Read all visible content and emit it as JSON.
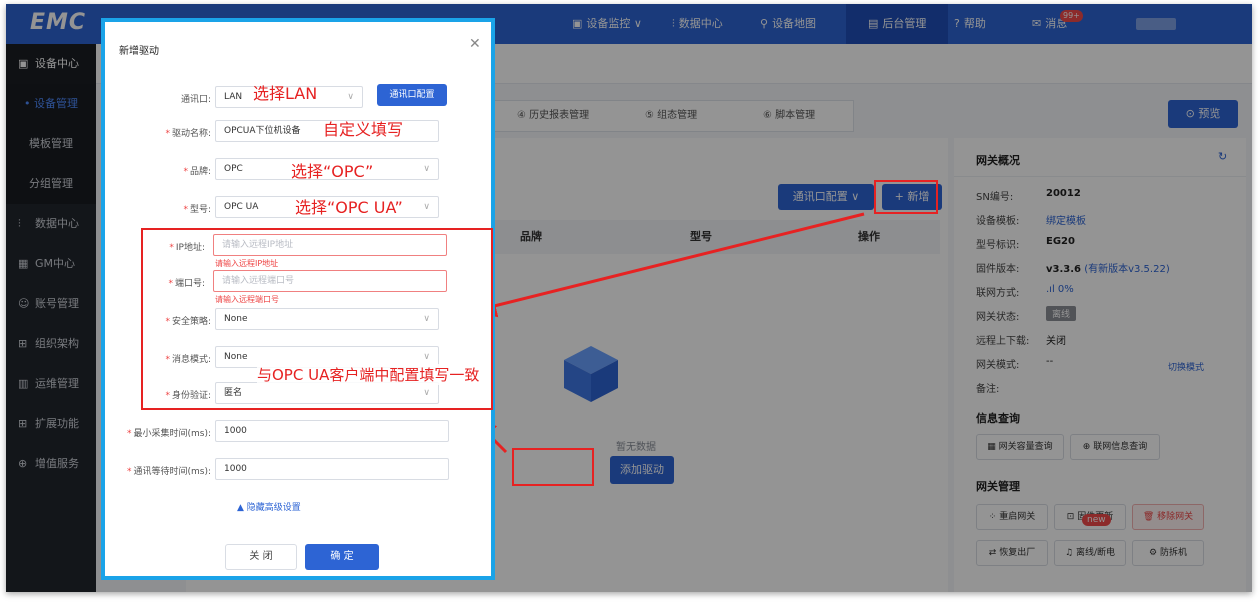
{
  "topbar": {
    "logo": "EMC",
    "nav": [
      {
        "label": "设备监控 ∨",
        "icon": "monitor-icon"
      },
      {
        "label": "数据中心",
        "icon": "chart-icon"
      },
      {
        "label": "设备地图",
        "icon": "map-icon"
      },
      {
        "label": "后台管理",
        "icon": "admin-icon"
      },
      {
        "label": "帮助",
        "icon": "help-icon"
      },
      {
        "label": "消息",
        "icon": "message-icon"
      }
    ],
    "msg_count": "99+"
  },
  "sidebar": {
    "header": "设备中心",
    "items": [
      "设备管理",
      "模板管理",
      "分组管理",
      "数据中心",
      "GM中心",
      "账号管理",
      "组织架构",
      "运维管理",
      "扩展功能",
      "增值服务"
    ]
  },
  "tabs": [
    "④ 历史报表管理",
    "⑤ 组态管理",
    "⑥ 脚本管理"
  ],
  "preview_label": "预览",
  "toolbar": {
    "comm_config": "通讯口配置 ∨",
    "add": "+ 新增"
  },
  "table": {
    "headers": [
      "品牌",
      "型号",
      "操作"
    ],
    "empty": "暂无数据",
    "add_driver": "添加驱动"
  },
  "gateway": {
    "title": "网关概况",
    "rows": [
      {
        "k": "SN编号:",
        "v": "20012"
      },
      {
        "k": "设备模板:",
        "v": "绑定模板"
      },
      {
        "k": "型号标识:",
        "v": "EG20"
      },
      {
        "k": "固件版本:",
        "v": "v3.3.6",
        "extra": "(有新版本v3.5.22)"
      },
      {
        "k": "联网方式:",
        "v": "0%"
      },
      {
        "k": "网关状态:",
        "v": "离线"
      },
      {
        "k": "远程上下载:",
        "v": "关闭"
      },
      {
        "k": "网关模式:",
        "v": "--"
      },
      {
        "k": "备注:",
        "v": ""
      }
    ],
    "switch_mode": "切换模式",
    "info_title": "信息查询",
    "info_btns": [
      "网关容量查询",
      "联网信息查询"
    ],
    "mgmt_title": "网关管理",
    "mgmt_btns": [
      "重启网关",
      "固件更新",
      "移除网关",
      "恢复出厂",
      "离线/断电",
      "防拆机"
    ],
    "new_badge": "new"
  },
  "modal": {
    "title": "新增驱动",
    "fields": [
      {
        "label": "通讯口:",
        "value": "LAN",
        "req": false
      },
      {
        "label": "驱动名称:",
        "value": "OPCUA下位机设备",
        "req": true
      },
      {
        "label": "品牌:",
        "value": "OPC",
        "req": true
      },
      {
        "label": "型号:",
        "value": "OPC UA",
        "req": true
      },
      {
        "label": "IP地址:",
        "value": "请输入远程IP地址",
        "req": true
      },
      {
        "label": "端口号:",
        "value": "请输入远程端口号",
        "req": true
      },
      {
        "label": "安全策略:",
        "value": "None",
        "req": true
      },
      {
        "label": "消息模式:",
        "value": "None",
        "req": true
      },
      {
        "label": "身份验证:",
        "value": "匿名",
        "req": true
      },
      {
        "label": "最小采集时间(ms):",
        "value": "1000",
        "req": true
      },
      {
        "label": "通讯等待时间(ms):",
        "value": "1000",
        "req": true
      }
    ],
    "errors": [
      "请输入远程IP地址",
      "请输入远程端口号"
    ],
    "comm_config_btn": "通讯口配置",
    "hide_advanced": "▲ 隐藏高级设置",
    "close": "关 闭",
    "ok": "确 定"
  },
  "annotations": {
    "lan": "选择LAN",
    "name": "自定义填写",
    "brand": "选择“OPC”",
    "model": "选择“OPC UA”",
    "consistent": "与OPC UA客户端中配置填写一致"
  }
}
